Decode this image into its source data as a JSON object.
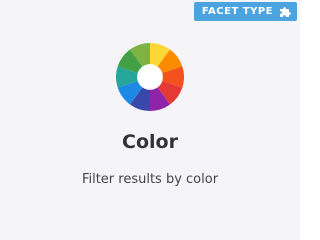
{
  "card": {
    "badge_label": "FACET TYPE",
    "badge_icon": "puzzle-icon",
    "title": "Color",
    "description": "Filter results by color"
  },
  "colors": {
    "badge_bg": "#4ba3e0",
    "card_bg": "#f5f5f7",
    "wheel_segments": [
      "#fdd835",
      "#fb8c00",
      "#f4511e",
      "#e53935",
      "#8e24aa",
      "#3949ab",
      "#1e88e5",
      "#26a69a",
      "#43a047",
      "#7cb342"
    ]
  },
  "icons": {
    "wheel": "color-wheel-icon"
  }
}
